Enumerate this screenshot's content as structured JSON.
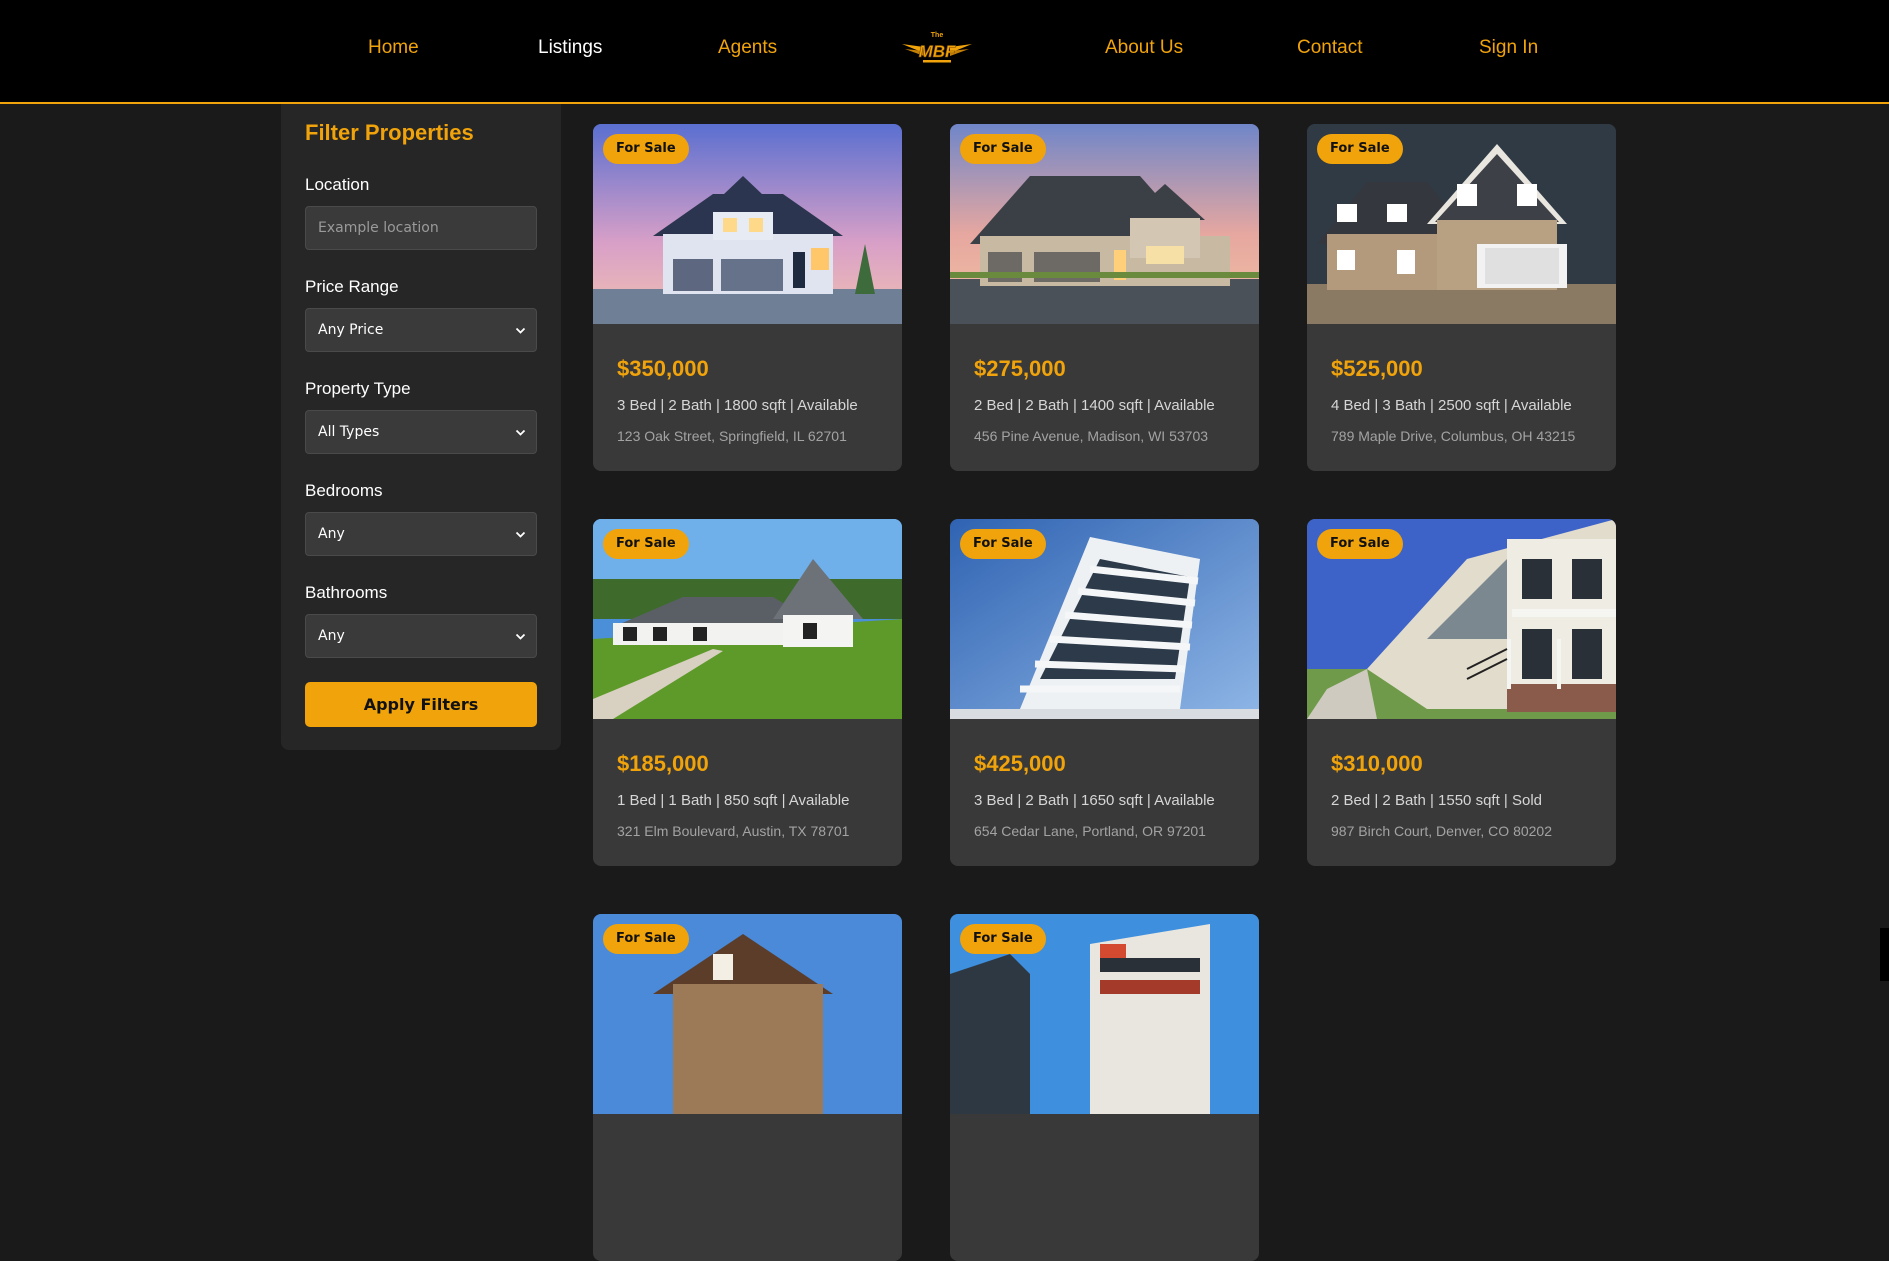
{
  "nav": {
    "links": [
      {
        "label": "Home",
        "active": false
      },
      {
        "label": "Listings",
        "active": true
      },
      {
        "label": "Agents",
        "active": false
      },
      {
        "label": "About Us",
        "active": false
      },
      {
        "label": "Contact",
        "active": false
      },
      {
        "label": "Sign In",
        "active": false
      }
    ],
    "logo": {
      "top": "The",
      "main": "MBF"
    }
  },
  "filters": {
    "title": "Filter Properties",
    "location": {
      "label": "Location",
      "placeholder": "Example location",
      "value": ""
    },
    "price": {
      "label": "Price Range",
      "value": "Any Price"
    },
    "type": {
      "label": "Property Type",
      "value": "All Types"
    },
    "bedrooms": {
      "label": "Bedrooms",
      "value": "Any"
    },
    "bathrooms": {
      "label": "Bathrooms",
      "value": "Any"
    },
    "apply_label": "Apply Filters"
  },
  "listings": [
    {
      "badge": "For Sale",
      "price": "$350,000",
      "details": "3 Bed | 2 Bath | 1800 sqft | Available",
      "address": "123 Oak Street, Springfield, IL 62701"
    },
    {
      "badge": "For Sale",
      "price": "$275,000",
      "details": "2 Bed | 2 Bath | 1400 sqft | Available",
      "address": "456 Pine Avenue, Madison, WI 53703"
    },
    {
      "badge": "For Sale",
      "price": "$525,000",
      "details": "4 Bed | 3 Bath | 2500 sqft | Available",
      "address": "789 Maple Drive, Columbus, OH 43215"
    },
    {
      "badge": "For Sale",
      "price": "$185,000",
      "details": "1 Bed | 1 Bath | 850 sqft | Available",
      "address": "321 Elm Boulevard, Austin, TX 78701"
    },
    {
      "badge": "For Sale",
      "price": "$425,000",
      "details": "3 Bed | 2 Bath | 1650 sqft | Available",
      "address": "654 Cedar Lane, Portland, OR 97201"
    },
    {
      "badge": "For Sale",
      "price": "$310,000",
      "details": "2 Bed | 2 Bath | 1550 sqft | Sold",
      "address": "987 Birch Court, Denver, CO 80202"
    },
    {
      "badge": "For Sale",
      "price": "",
      "details": "",
      "address": ""
    },
    {
      "badge": "For Sale",
      "price": "",
      "details": "",
      "address": ""
    }
  ],
  "colors": {
    "accent": "#f0a30a",
    "page_bg": "#1a1a1a",
    "nav_bg": "#000000",
    "card_bg": "#393939",
    "sidebar_bg": "#262626"
  },
  "icons": {
    "select_caret": "chevron-down-icon",
    "logo": "mbf-winged-logo"
  }
}
